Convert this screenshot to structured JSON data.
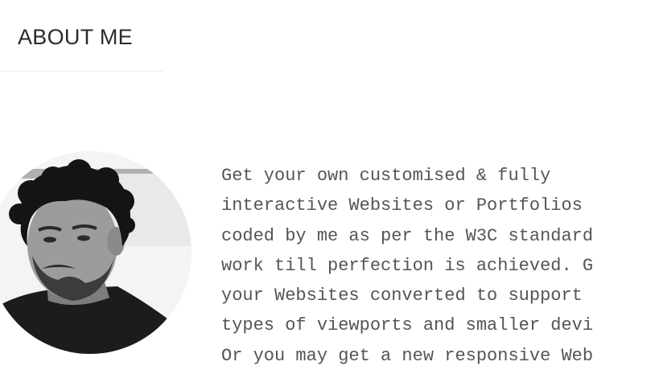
{
  "section": {
    "heading": "ABOUT ME"
  },
  "profile": {
    "photo_icon": "portrait-photo"
  },
  "about": {
    "lines": [
      "Get your own customised & fully",
      "interactive Websites or Portfolios",
      "coded by me as per the W3C standard",
      "work till perfection is achieved. G",
      "your Websites converted to support",
      "types of viewports and smaller devi",
      "Or you may get a new responsive Web"
    ]
  },
  "colors": {
    "heading": "#2b2b2b",
    "body_text": "#555555",
    "divider": "#ececec",
    "background": "#ffffff"
  }
}
